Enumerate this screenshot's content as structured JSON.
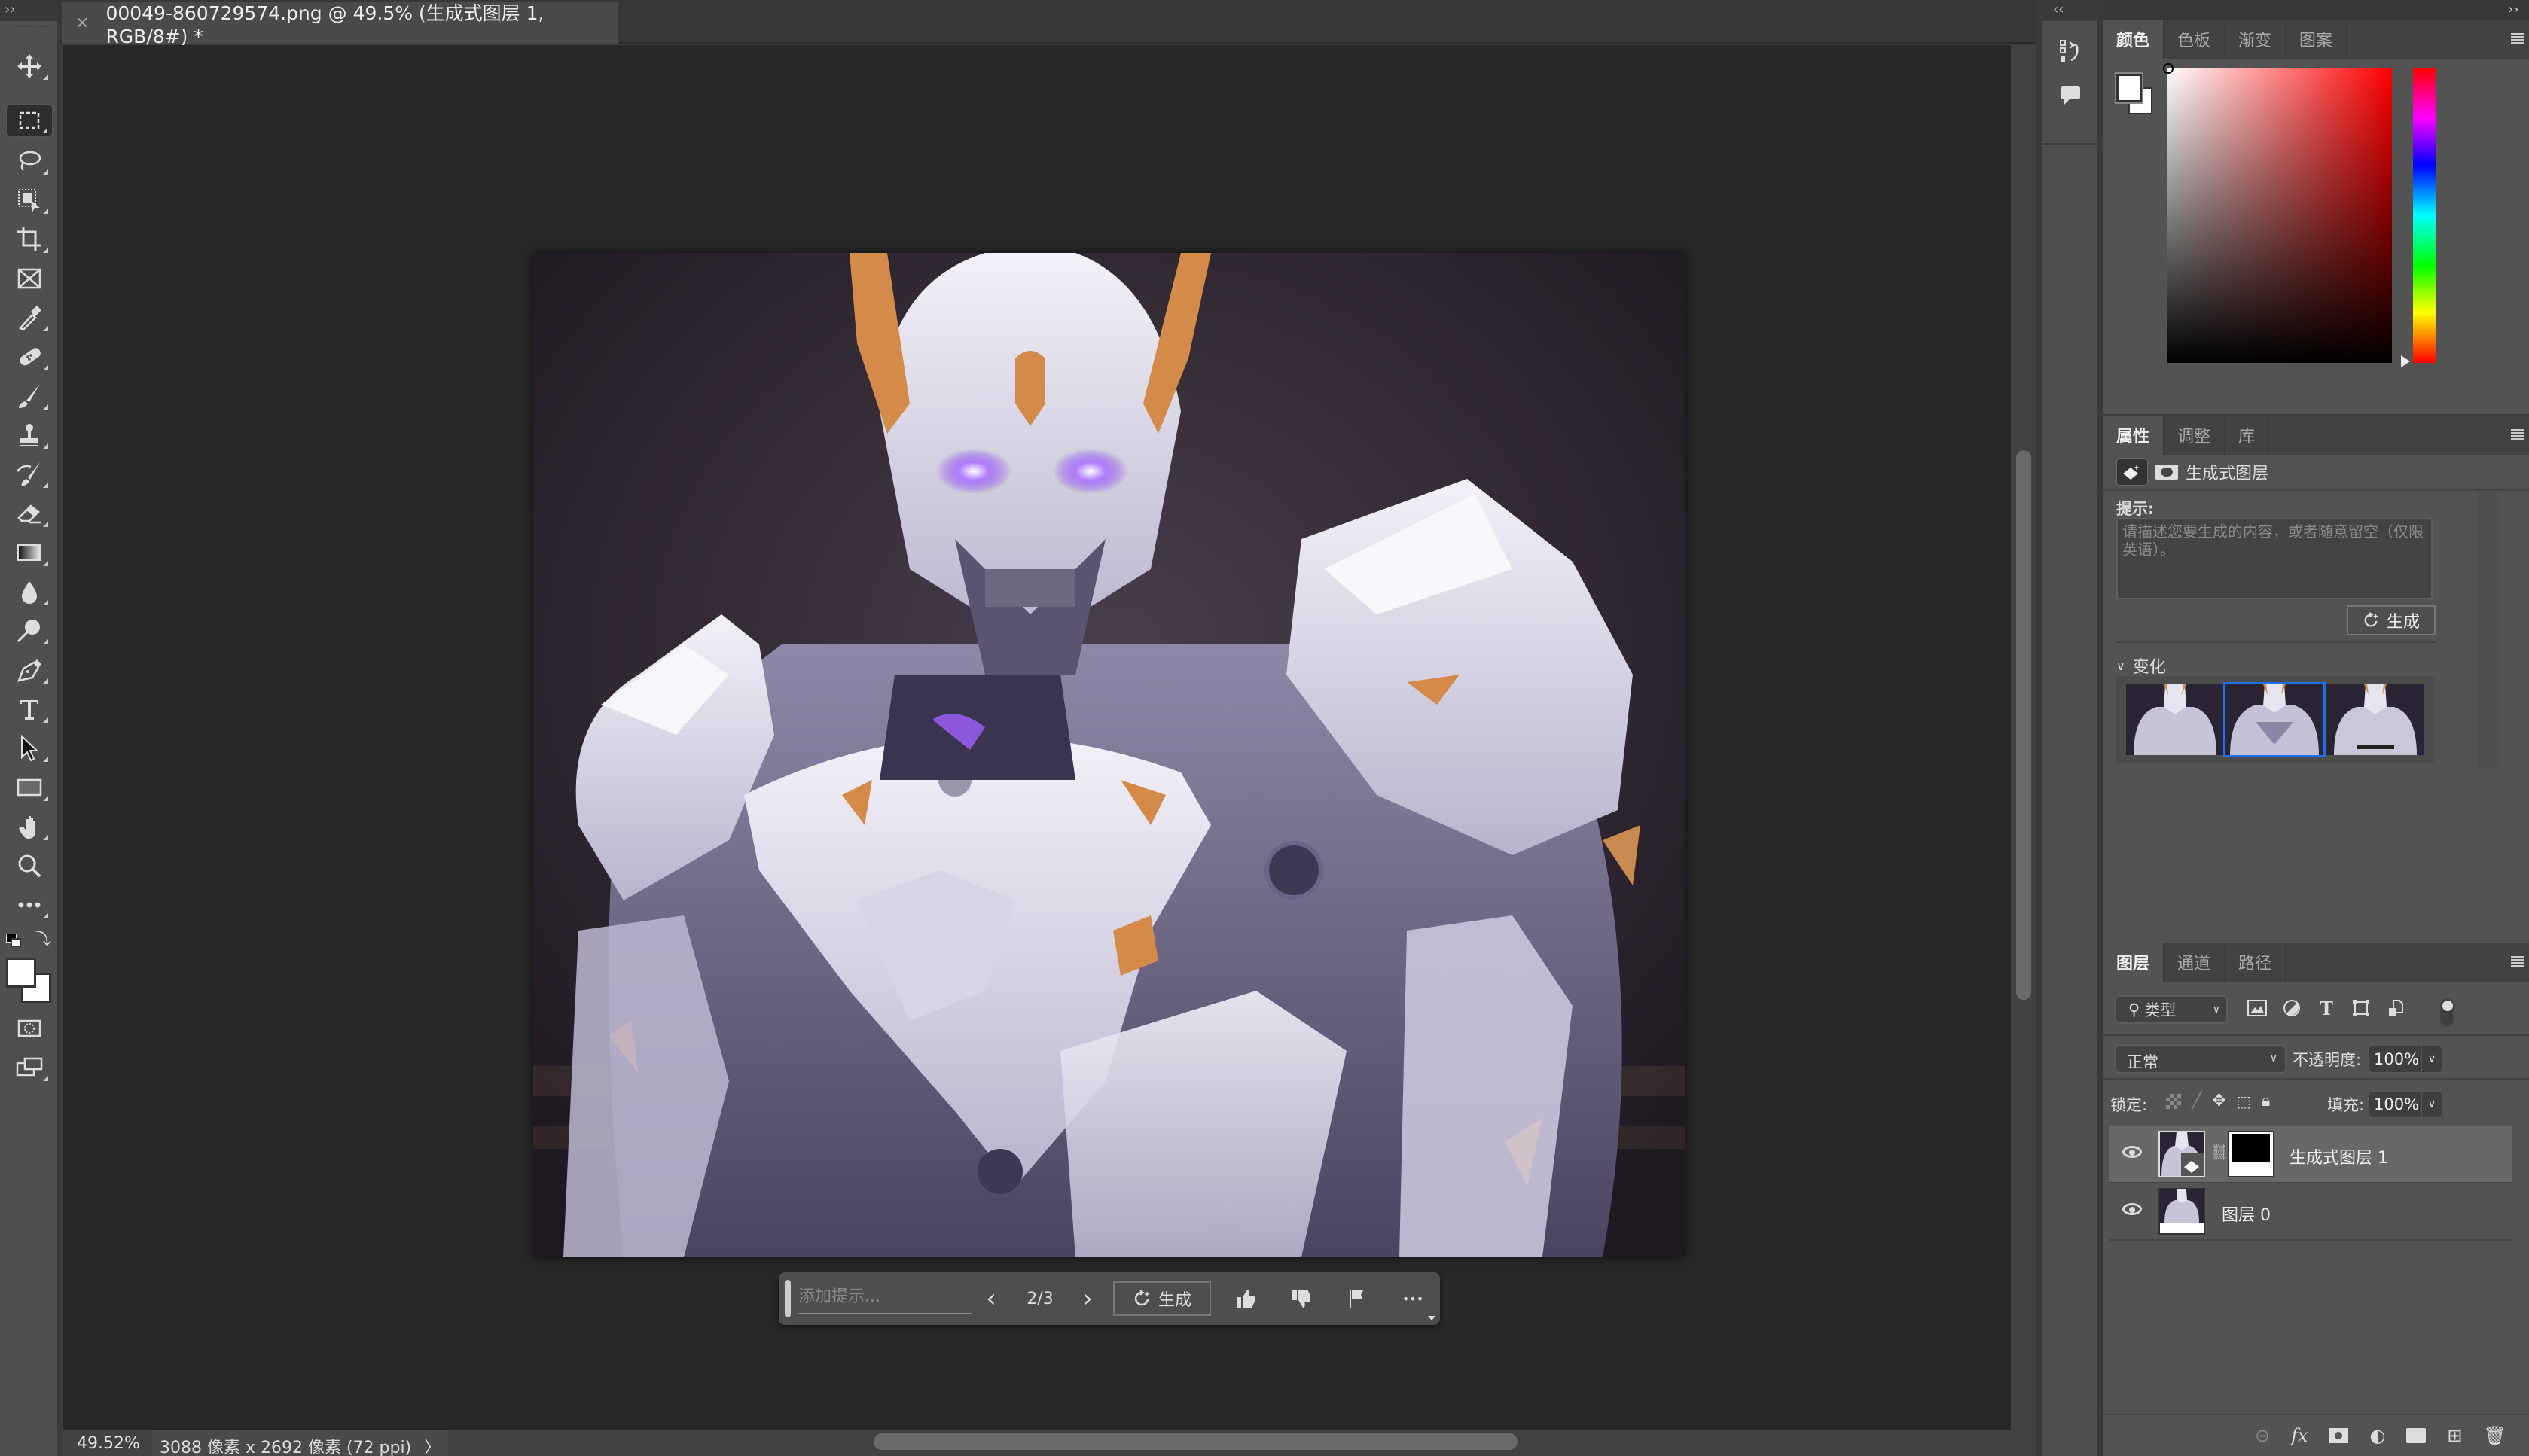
{
  "document_tab": {
    "close_glyph": "×",
    "title": "00049-860729574.png @ 49.5% (生成式图层 1, RGB/8#) *"
  },
  "toolbar": {
    "collapse_glyph": "››",
    "tools": [
      {
        "name": "move-tool",
        "icon": "move-icon"
      },
      {
        "name": "rectangular-marquee-tool",
        "icon": "marquee-icon",
        "active": true
      },
      {
        "name": "lasso-tool",
        "icon": "lasso-icon"
      },
      {
        "name": "object-selection-tool",
        "icon": "object-selection-icon"
      },
      {
        "name": "crop-tool",
        "icon": "crop-icon"
      },
      {
        "name": "frame-tool",
        "icon": "frame-icon"
      },
      {
        "name": "eyedropper-tool",
        "icon": "eyedropper-icon"
      },
      {
        "name": "healing-brush-tool",
        "icon": "bandage-icon"
      },
      {
        "name": "brush-tool",
        "icon": "brush-icon"
      },
      {
        "name": "clone-stamp-tool",
        "icon": "stamp-icon"
      },
      {
        "name": "history-brush-tool",
        "icon": "history-brush-icon"
      },
      {
        "name": "eraser-tool",
        "icon": "eraser-icon"
      },
      {
        "name": "gradient-tool",
        "icon": "gradient-icon"
      },
      {
        "name": "blur-tool",
        "icon": "drop-icon"
      },
      {
        "name": "dodge-tool",
        "icon": "dodge-icon"
      },
      {
        "name": "pen-tool",
        "icon": "pen-icon"
      },
      {
        "name": "type-tool",
        "icon": "type-icon"
      },
      {
        "name": "path-selection-tool",
        "icon": "arrow-icon"
      },
      {
        "name": "rectangle-tool",
        "icon": "rectangle-icon"
      },
      {
        "name": "hand-tool",
        "icon": "hand-icon"
      },
      {
        "name": "zoom-tool",
        "icon": "magnifier-icon"
      },
      {
        "name": "edit-toolbar",
        "icon": "more-icon"
      }
    ],
    "foreground_color": "#ffffff",
    "background_color": "#ffffff"
  },
  "context_bar": {
    "prompt_placeholder": "添加提示...",
    "prev_glyph": "‹",
    "counter": "2/3",
    "next_glyph": "›",
    "generate_label": "生成",
    "more_glyph": "•••"
  },
  "status_bar": {
    "zoom": "49.52%",
    "doc_info": "3088 像素 x 2692 像素 (72 ppi)",
    "more_glyph": "〉"
  },
  "color_panel": {
    "tabs": [
      "颜色",
      "色板",
      "渐变",
      "图案"
    ],
    "active_tab": "颜色",
    "hue_color": "#ff0000",
    "foreground_color": "#ffffff",
    "background_color": "#ffffff"
  },
  "properties_panel": {
    "tabs": [
      "属性",
      "调整",
      "库"
    ],
    "active_tab": "属性",
    "layer_type": "生成式图层",
    "prompt_label": "提示:",
    "prompt_placeholder": "请描述您要生成的内容，或者随意留空（仅限英语）。",
    "generate_label": "生成",
    "variations_label": "变化",
    "variations_count": 3,
    "selected_variation": 2
  },
  "layers_panel": {
    "tabs": [
      "图层",
      "通道",
      "路径"
    ],
    "active_tab": "图层",
    "filter_label": "类型",
    "blend_mode": "正常",
    "opacity_label": "不透明度:",
    "opacity": "100%",
    "lock_label": "锁定:",
    "fill_label": "填充:",
    "fill": "100%",
    "layers": [
      {
        "name": "生成式图层 1",
        "visible": true,
        "selected": true,
        "has_mask": true
      },
      {
        "name": "图层 0",
        "visible": true,
        "selected": false,
        "has_mask": false
      }
    ],
    "footer_icons": [
      "link-icon",
      "fx-icon",
      "add-mask-icon",
      "adjustment-icon",
      "group-folder-icon",
      "new-layer-icon",
      "trash-icon"
    ]
  }
}
